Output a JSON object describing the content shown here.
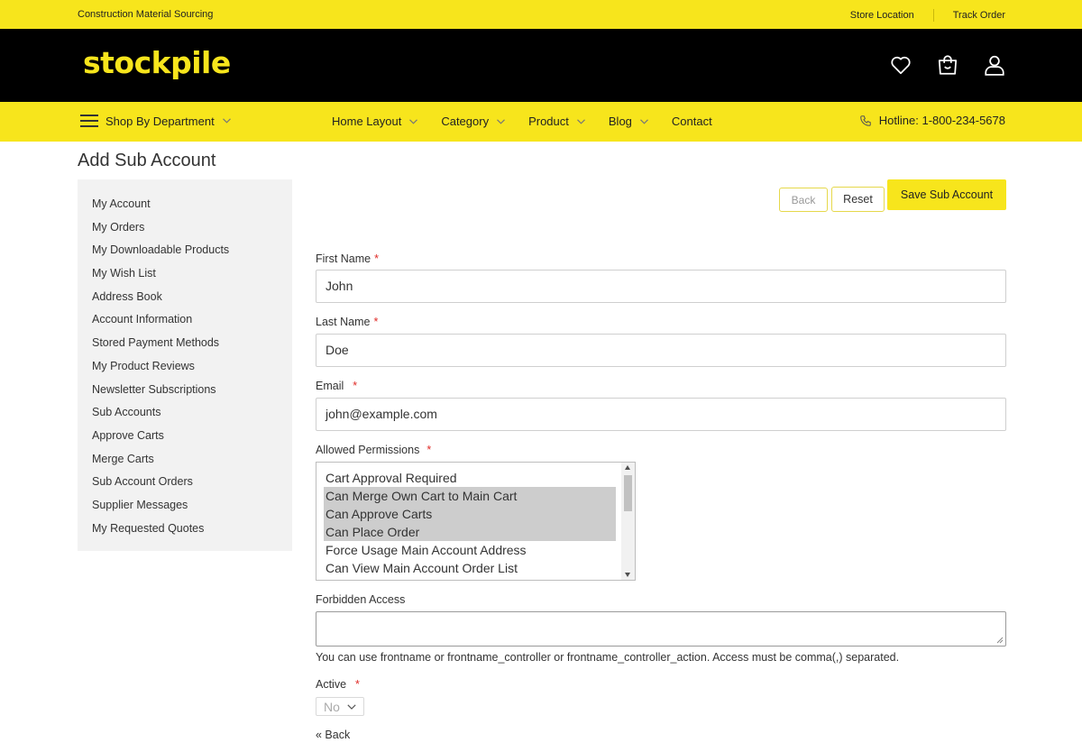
{
  "topbar": {
    "tagline": "Construction Material Sourcing",
    "store_location": "Store Location",
    "track_order": "Track Order"
  },
  "header": {
    "logo": "stockpile",
    "icons": [
      "heart-icon",
      "shopping-bag-icon",
      "user-icon"
    ]
  },
  "nav": {
    "department": "Shop By Department",
    "items": [
      "Home Layout",
      "Category",
      "Product",
      "Blog",
      "Contact"
    ],
    "hotline": "Hotline: 1-800-234-5678"
  },
  "page": {
    "title": "Add Sub Account"
  },
  "sidebar": {
    "items": [
      "My Account",
      "My Orders",
      "My Downloadable Products",
      "My Wish List",
      "Address Book",
      "Account Information",
      "Stored Payment Methods",
      "My Product Reviews",
      "Newsletter Subscriptions",
      "Sub Accounts",
      "Approve Carts",
      "Merge Carts",
      "Sub Account Orders",
      "Supplier Messages",
      "My Requested Quotes"
    ]
  },
  "actions": {
    "back": "Back",
    "reset": "Reset",
    "save": "Save Sub Account"
  },
  "form": {
    "first_name_label": "First Name",
    "first_name_value": "John",
    "last_name_label": "Last Name",
    "last_name_value": "Doe",
    "email_label": "Email",
    "email_value": "john@example.com",
    "permissions_label": "Allowed Permissions",
    "permissions_options": [
      {
        "label": "Cart Approval Required",
        "selected": false
      },
      {
        "label": "Can Merge Own Cart to Main Cart",
        "selected": true
      },
      {
        "label": "Can Approve Carts",
        "selected": true
      },
      {
        "label": "Can Place Order",
        "selected": true
      },
      {
        "label": "Force Usage Main Account Address",
        "selected": false
      },
      {
        "label": "Can View Main Account Order List",
        "selected": false
      }
    ],
    "forbidden_label": "Forbidden Access",
    "forbidden_value": "",
    "forbidden_note": "You can use frontname or frontname_controller or frontname_controller_action. Access must be comma(,) separated.",
    "active_label": "Active",
    "active_value": "No",
    "required_mark": "*",
    "back_link": "« Back"
  },
  "colors": {
    "brand_yellow": "#f7e51c",
    "header_black": "#000000",
    "required_red": "#e02b27"
  }
}
